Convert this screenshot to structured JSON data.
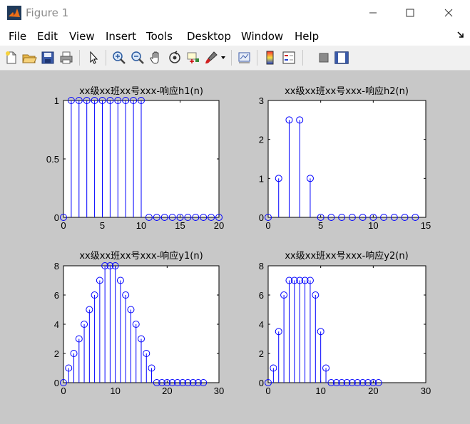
{
  "window": {
    "title": "Figure 1"
  },
  "menu": {
    "items": [
      "File",
      "Edit",
      "View",
      "Insert",
      "Tools",
      "Desktop",
      "Window",
      "Help"
    ]
  },
  "toolbar": {
    "icons": [
      "new-figure-icon",
      "open-file-icon",
      "save-icon",
      "print-icon",
      "pointer-icon",
      "zoom-in-icon",
      "zoom-out-icon",
      "pan-icon",
      "rotate-3d-icon",
      "data-cursor-icon",
      "brush-icon",
      "link-plot-icon",
      "colorbar-icon",
      "legend-icon",
      "hide-plot-tools-icon",
      "show-plot-tools-icon"
    ]
  },
  "colors": {
    "stem": "#0000ff",
    "figure_bg": "#c8c8c8",
    "axes_bg": "#ffffff"
  },
  "chart_data": [
    {
      "type": "stem",
      "title": "xx级xx班xx号xxx-响应h1(n)",
      "x": [
        0,
        1,
        2,
        3,
        4,
        5,
        6,
        7,
        8,
        9,
        10,
        11,
        12,
        13,
        14,
        15,
        16,
        17,
        18,
        19,
        20
      ],
      "y": [
        0,
        1,
        1,
        1,
        1,
        1,
        1,
        1,
        1,
        1,
        1,
        0,
        0,
        0,
        0,
        0,
        0,
        0,
        0,
        0,
        0
      ],
      "xlim": [
        0,
        20
      ],
      "ylim": [
        0,
        1
      ],
      "xticks": [
        0,
        5,
        10,
        15,
        20
      ],
      "yticks": [
        0,
        0.5,
        1
      ],
      "grid": false
    },
    {
      "type": "stem",
      "title": "xx级xx班xx号xxx-响应h2(n)",
      "x": [
        0,
        1,
        2,
        3,
        4,
        5,
        6,
        7,
        8,
        9,
        10,
        11,
        12,
        13,
        14
      ],
      "y": [
        0,
        1,
        2.5,
        2.5,
        1,
        0,
        0,
        0,
        0,
        0,
        0,
        0,
        0,
        0,
        0
      ],
      "xlim": [
        0,
        15
      ],
      "ylim": [
        0,
        3
      ],
      "xticks": [
        0,
        5,
        10,
        15
      ],
      "yticks": [
        0,
        1,
        2,
        3
      ],
      "grid": false
    },
    {
      "type": "stem",
      "title": "xx级xx班xx号xxx-响应y1(n)",
      "x": [
        0,
        1,
        2,
        3,
        4,
        5,
        6,
        7,
        8,
        9,
        10,
        11,
        12,
        13,
        14,
        15,
        16,
        17,
        18,
        19,
        20,
        21,
        22,
        23,
        24,
        25,
        26,
        27
      ],
      "y": [
        0,
        1,
        2,
        3,
        4,
        5,
        6,
        7,
        8,
        8,
        8,
        7,
        6,
        5,
        4,
        3,
        2,
        1,
        0,
        0,
        0,
        0,
        0,
        0,
        0,
        0,
        0,
        0
      ],
      "xlim": [
        0,
        30
      ],
      "ylim": [
        0,
        8
      ],
      "xticks": [
        0,
        10,
        20,
        30
      ],
      "yticks": [
        0,
        2,
        4,
        6,
        8
      ],
      "grid": false
    },
    {
      "type": "stem",
      "title": "xx级xx班xx号xxx-响应y2(n)",
      "x": [
        0,
        1,
        2,
        3,
        4,
        5,
        6,
        7,
        8,
        9,
        10,
        11,
        12,
        13,
        14,
        15,
        16,
        17,
        18,
        19,
        20,
        21
      ],
      "y": [
        0,
        1,
        3.5,
        6,
        7,
        7,
        7,
        7,
        7,
        6,
        3.5,
        1,
        0,
        0,
        0,
        0,
        0,
        0,
        0,
        0,
        0,
        0
      ],
      "xlim": [
        0,
        30
      ],
      "ylim": [
        0,
        8
      ],
      "xticks": [
        0,
        10,
        20,
        30
      ],
      "yticks": [
        0,
        2,
        4,
        6,
        8
      ],
      "grid": false
    }
  ]
}
